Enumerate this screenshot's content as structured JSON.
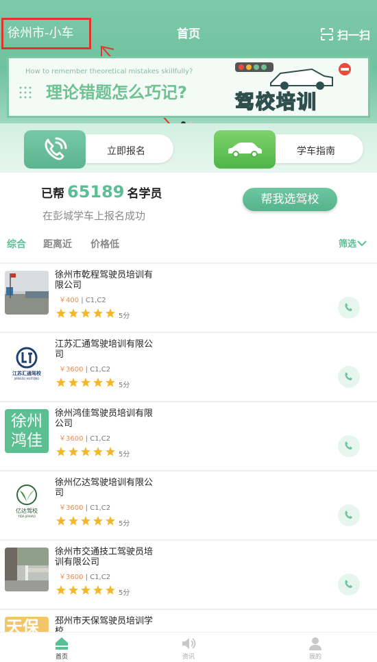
{
  "header": {
    "city": "徐州市-小车",
    "title": "首页",
    "scan_label": "扫一扫"
  },
  "banner": {
    "english": "How to remember theoretical mistakes skillfully?",
    "headline": "理论错题怎么巧记?",
    "brand": "驾校培训"
  },
  "quick_actions": [
    {
      "label": "立即报名",
      "icon": "phone-icon"
    },
    {
      "label": "学车指南",
      "icon": "car-icon"
    }
  ],
  "stats": {
    "prefix": "已帮",
    "count": "65189",
    "suffix": "名学员",
    "subtitle": "在彭城学车上报名成功",
    "help_button": "帮我选驾校"
  },
  "filters": {
    "tabs": [
      "综合",
      "距离近",
      "价格低"
    ],
    "active_index": 0,
    "sift_label": "筛选"
  },
  "schools": [
    {
      "name": "徐州市乾程驾驶员培训有限公司",
      "price": "￥400",
      "classes": "C1,C2",
      "score": "5分",
      "rating": 5,
      "thumb": "photo-yard"
    },
    {
      "name": "江苏汇通驾驶培训有限公司",
      "price": "￥3600",
      "classes": "C1,C2",
      "score": "5分",
      "rating": 5,
      "thumb": "logo-huitong",
      "logo_text": "江苏汇通驾校",
      "logo_sub": "JIANGSU HUITONG"
    },
    {
      "name": "徐州鸿佳驾驶员培训有限公司",
      "price": "￥3600",
      "classes": "C1,C2",
      "score": "5分",
      "rating": 5,
      "thumb": "logo-hongjia",
      "logo_text": "徐州鸿佳"
    },
    {
      "name": "徐州亿达驾驶培训有限公司",
      "price": "￥3600",
      "classes": "C1,C2",
      "score": "5分",
      "rating": 5,
      "thumb": "logo-yida",
      "logo_text": "亿达驾校",
      "logo_sub": "YIDA JIAXIAO"
    },
    {
      "name": "徐州市交通技工驾驶员培训有限公司",
      "price": "￥3600",
      "classes": "C1,C2",
      "score": "5分",
      "rating": 5,
      "thumb": "photo-gate"
    },
    {
      "name": "邳州市天保驾驶员培训学校",
      "price": "",
      "classes": "",
      "score": "",
      "rating": 0,
      "thumb": "logo-tianbao",
      "logo_text": "天保"
    }
  ],
  "tabbar": [
    {
      "label": "首页",
      "icon": "home-icon",
      "active": true
    },
    {
      "label": "资讯",
      "icon": "speaker-icon",
      "active": false
    },
    {
      "label": "我的",
      "icon": "user-icon",
      "active": false
    }
  ],
  "colors": {
    "brand_green": "#6fc29f",
    "highlight_red": "#e2342f",
    "price_orange": "#f08b4a",
    "star_yellow": "#f5b72a"
  }
}
